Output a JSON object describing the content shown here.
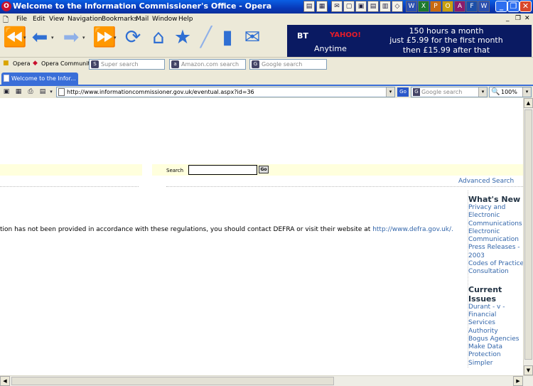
{
  "window": {
    "title": "Welcome to the Information Commissioner's Office - Opera"
  },
  "menu": [
    "File",
    "Edit",
    "View",
    "Navigation",
    "Bookmarks",
    "Mail",
    "Window",
    "Help"
  ],
  "ad": {
    "brand": "BT",
    "partner": "YAHOO!",
    "product": "Anytime",
    "line1": "150 hours a month",
    "line2": "just £5.99 for the first month",
    "line3": "then £15.99 after that"
  },
  "personal_bar": {
    "opera": "Opera",
    "community": "Opera Community",
    "search1": "Super search",
    "search2": "Amazon.com search",
    "search3": "Google search"
  },
  "tab": {
    "label": "Welcome to the Infor..."
  },
  "address": {
    "url": "http://www.informationcommissioner.gov.uk/eventual.aspx?id=36",
    "go": "Go",
    "search_placeholder": "Google search",
    "zoom": "100%"
  },
  "page": {
    "search_label": "Search",
    "search_go": "Go",
    "advanced_search": "Advanced Search",
    "body_text": "tion has not been provided in accordance with these regulations, you should contact DEFRA or visit their website at ",
    "body_link": "http://www.defra.gov.uk/.",
    "whats_new_heading": "What's New",
    "whats_new_items": [
      "Privacy and Electronic Communications",
      "Electronic Communication Press Releases - 2003",
      "Codes of Practice Consultation"
    ],
    "current_heading": "Current Issues",
    "current_items": [
      "Durant - v - Financial Services Authority",
      "Bogus Agencies",
      "Make Data Protection Simpler"
    ]
  }
}
